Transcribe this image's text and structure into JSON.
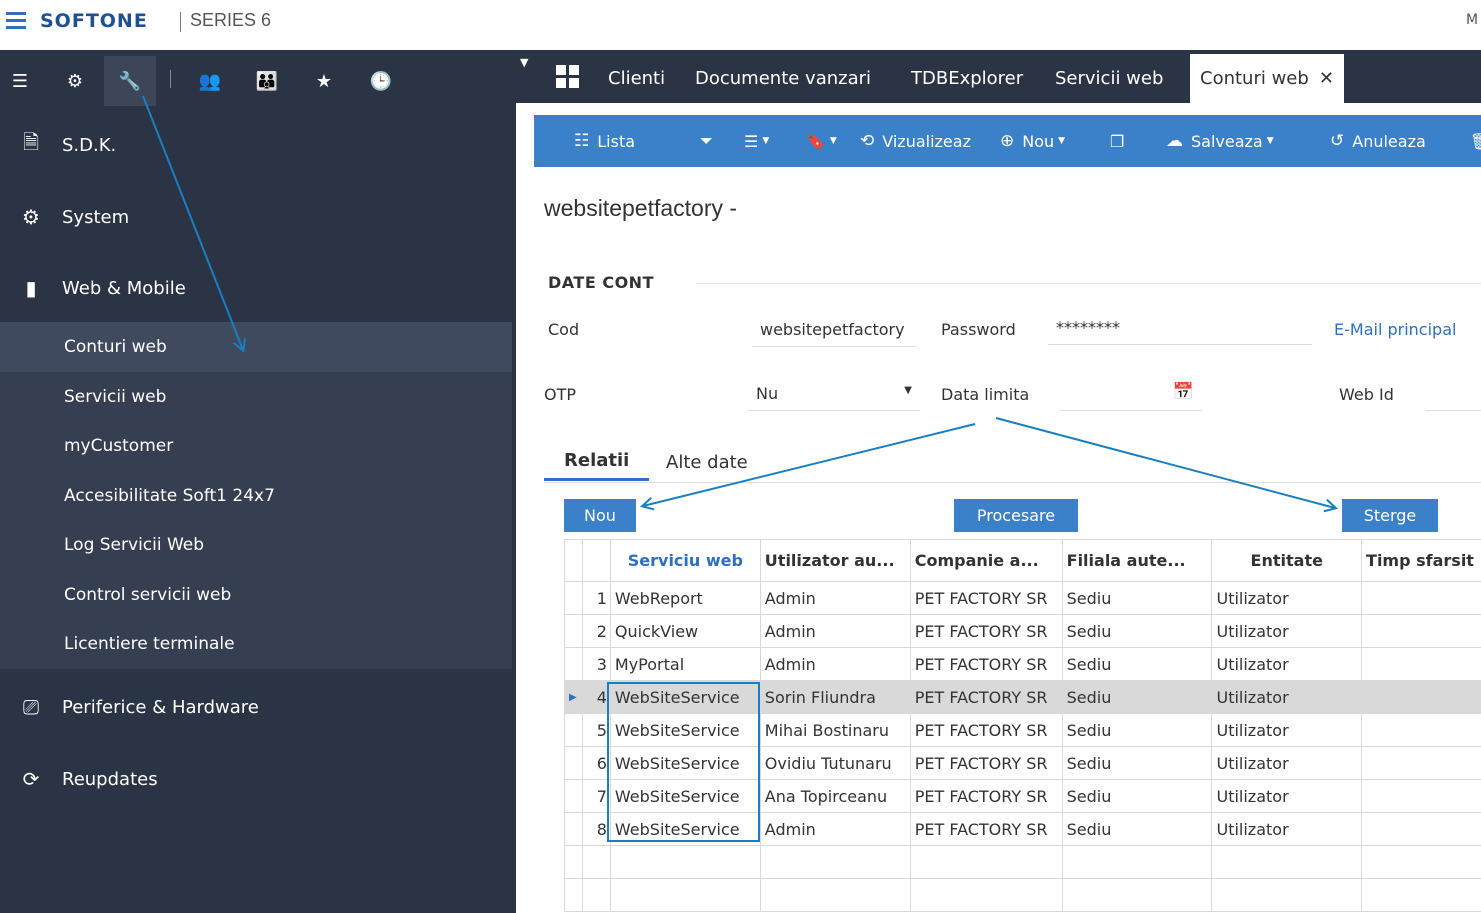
{
  "topbar": {
    "brand": "SOFTONE",
    "series": "SERIES 6",
    "right_text": "M"
  },
  "sidebar": {
    "tools": [
      "list-icon",
      "gear-icon",
      "wrench-icon",
      "users-list-icon",
      "users-icon",
      "star-icon",
      "clock-icon"
    ],
    "main_items": [
      {
        "label": "S.D.K.",
        "icon": "sdk-icon"
      },
      {
        "label": "System",
        "icon": "gear-icon"
      },
      {
        "label": "Web & Mobile",
        "icon": "mobile-icon"
      },
      {
        "label": "Periferice & Hardware",
        "icon": "hardware-icon"
      },
      {
        "label": "Reupdates",
        "icon": "reupdates-icon"
      }
    ],
    "sub_items": [
      {
        "label": "Conturi web"
      },
      {
        "label": "Servicii web"
      },
      {
        "label": "myCustomer"
      },
      {
        "label": "Accesibilitate Soft1 24x7"
      },
      {
        "label": "Log Servicii Web"
      },
      {
        "label": "Control servicii web"
      },
      {
        "label": "Licentiere terminale"
      }
    ]
  },
  "tabs": [
    {
      "label": "Clienti"
    },
    {
      "label": "Documente vanzari"
    },
    {
      "label": "TDBExplorer"
    },
    {
      "label": "Servicii web"
    },
    {
      "label": "Conturi web",
      "close": "✕"
    }
  ],
  "toolbar": {
    "lista": "Lista",
    "vizualizeaza": "Vizualizeaz",
    "nou": "Nou",
    "salveaza": "Salveaza",
    "anuleaza": "Anuleaza"
  },
  "record": {
    "title": "websitepetfactory -",
    "section": "DATE CONT",
    "cod_label": "Cod",
    "cod_value": "websitepetfactory",
    "password_label": "Password",
    "password_value": "********",
    "email_link": "E-Mail principal",
    "otp_label": "OTP",
    "otp_value": "Nu",
    "data_limita_label": "Data limita",
    "data_limita_value": "",
    "webid_label": "Web Id"
  },
  "subtabs": [
    {
      "label": "Relatii"
    },
    {
      "label": "Alte date"
    }
  ],
  "buttons": {
    "nou": "Nou",
    "procesare": "Procesare",
    "sterge": "Sterge"
  },
  "grid": {
    "headers": [
      "Serviciu web",
      "Utilizator au...",
      "Companie a...",
      "Filiala aute...",
      "Entitate",
      "Timp sfarsit"
    ],
    "rows": [
      {
        "num": "1",
        "serviciu": "WebReport",
        "utilizator": "Admin",
        "companie": "PET FACTORY SR",
        "filiala": "Sediu",
        "entitate": "Utilizator"
      },
      {
        "num": "2",
        "serviciu": "QuickView",
        "utilizator": "Admin",
        "companie": "PET FACTORY SR",
        "filiala": "Sediu",
        "entitate": "Utilizator"
      },
      {
        "num": "3",
        "serviciu": "MyPortal",
        "utilizator": "Admin",
        "companie": "PET FACTORY SR",
        "filiala": "Sediu",
        "entitate": "Utilizator"
      },
      {
        "num": "4",
        "serviciu": "WebSiteService",
        "utilizator": "Sorin Fliundra",
        "companie": "PET FACTORY SR",
        "filiala": "Sediu",
        "entitate": "Utilizator"
      },
      {
        "num": "5",
        "serviciu": "WebSiteService",
        "utilizator": "Mihai Bostinaru",
        "companie": "PET FACTORY SR",
        "filiala": "Sediu",
        "entitate": "Utilizator"
      },
      {
        "num": "6",
        "serviciu": "WebSiteService",
        "utilizator": "Ovidiu Tutunaru",
        "companie": "PET FACTORY SR",
        "filiala": "Sediu",
        "entitate": "Utilizator"
      },
      {
        "num": "7",
        "serviciu": "WebSiteService",
        "utilizator": "Ana Topirceanu",
        "companie": "PET FACTORY SR",
        "filiala": "Sediu",
        "entitate": "Utilizator"
      },
      {
        "num": "8",
        "serviciu": "WebSiteService",
        "utilizator": "Admin",
        "companie": "PET FACTORY SR",
        "filiala": "Sediu",
        "entitate": "Utilizator"
      }
    ],
    "selected_row": 4
  },
  "colors": {
    "sidebar_bg": "#2b3444",
    "accent": "#3a81c9",
    "link": "#2d6fc0",
    "annotation": "#1a7fc0"
  }
}
